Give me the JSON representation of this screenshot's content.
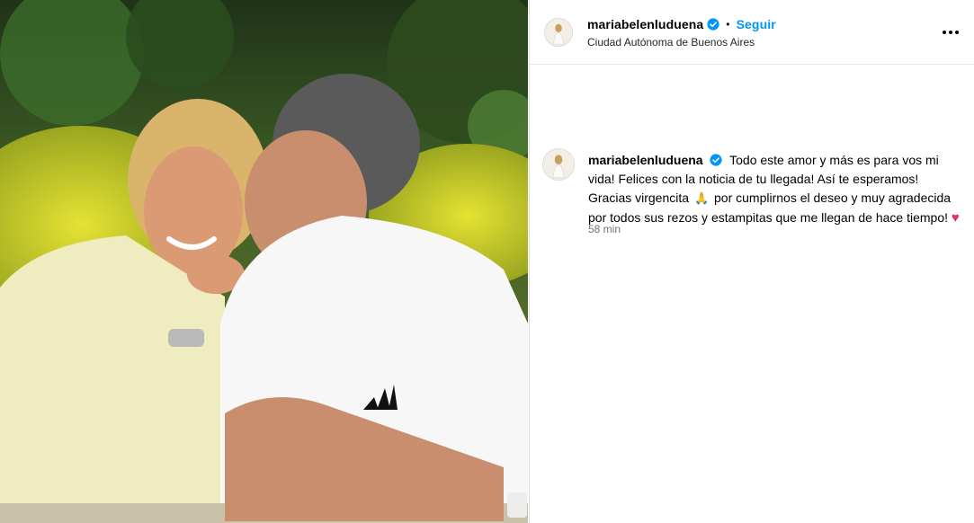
{
  "post": {
    "author": "mariabelenluduena",
    "follow_label": "Seguir",
    "separator": "•",
    "location": "Ciudad Autónoma de Buenos Aires",
    "more_icon": "more-options-icon"
  },
  "caption": {
    "author": "mariabelenluduena",
    "text_part1": "Todo este amor y más es para vos mi vida! Felices con la noticia de tu llegada! Así te esperamos! Gracias virgencita",
    "praying_emoji": "🙏",
    "text_part2": "por cumplirnos el deseo y muy agradecida por todos sus rezos y estampitas que me llegan de hace tiempo!",
    "heart_emoji": "♥",
    "time": "58 min"
  },
  "colors": {
    "link": "#0095f6",
    "verified": "#0095f6",
    "muted": "#737373",
    "heart": "#e1306c"
  }
}
